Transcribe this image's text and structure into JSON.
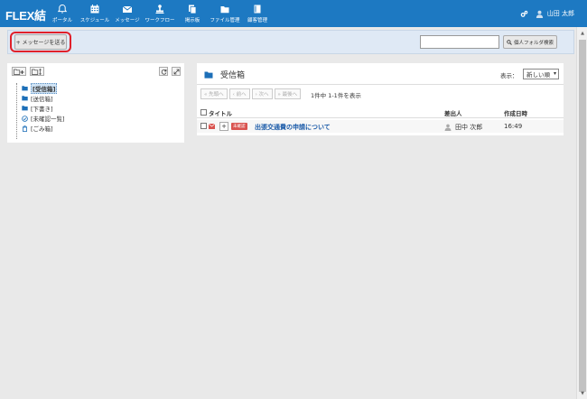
{
  "app": {
    "logo": "FLEX結"
  },
  "nav": [
    {
      "label": "ポータル",
      "icon": "bell-icon"
    },
    {
      "label": "スケジュール",
      "icon": "calendar-icon"
    },
    {
      "label": "メッセージ",
      "icon": "envelope-icon"
    },
    {
      "label": "ワークフロー",
      "icon": "stamp-icon"
    },
    {
      "label": "掲示板",
      "icon": "board-icon"
    },
    {
      "label": "ファイル管理",
      "icon": "folder-icon"
    },
    {
      "label": "顧客管理",
      "icon": "book-icon"
    }
  ],
  "header": {
    "user_name": "山田 太郎"
  },
  "toolbar": {
    "send_label": "+ メッセージを送る",
    "search_placeholder": "",
    "search_button_label": "個人フォルダ検索"
  },
  "tree": {
    "items": [
      {
        "label": "[受信箱]",
        "icon": "folder-icon",
        "selected": true
      },
      {
        "label": "[送信箱]",
        "icon": "folder-icon",
        "selected": false
      },
      {
        "label": "[下書き]",
        "icon": "folder-icon",
        "selected": false
      },
      {
        "label": "[未確認一覧]",
        "icon": "check-circle-icon",
        "selected": false
      },
      {
        "label": "[ごみ箱]",
        "icon": "trash-icon",
        "selected": false
      }
    ]
  },
  "panel": {
    "title": "受信箱",
    "display_label": "表示：",
    "sort_value": "新しい順",
    "pager": [
      "« 先頭へ",
      "‹ 前へ",
      "› 次へ",
      "» 最後へ"
    ],
    "page_info": "1件中 1-1件を表示",
    "columns": {
      "title": "タイトル",
      "sender": "差出人",
      "date": "作成日時"
    },
    "rows": [
      {
        "badge": "未確認",
        "title": "出張交通費の申請について",
        "sender": "田中 次郎",
        "date": "16:49"
      }
    ]
  },
  "colors": {
    "header_bg": "#1d79c2",
    "unread_badge": "#d9534f",
    "link": "#1a5aa8",
    "highlight_ring": "#e0202a"
  }
}
